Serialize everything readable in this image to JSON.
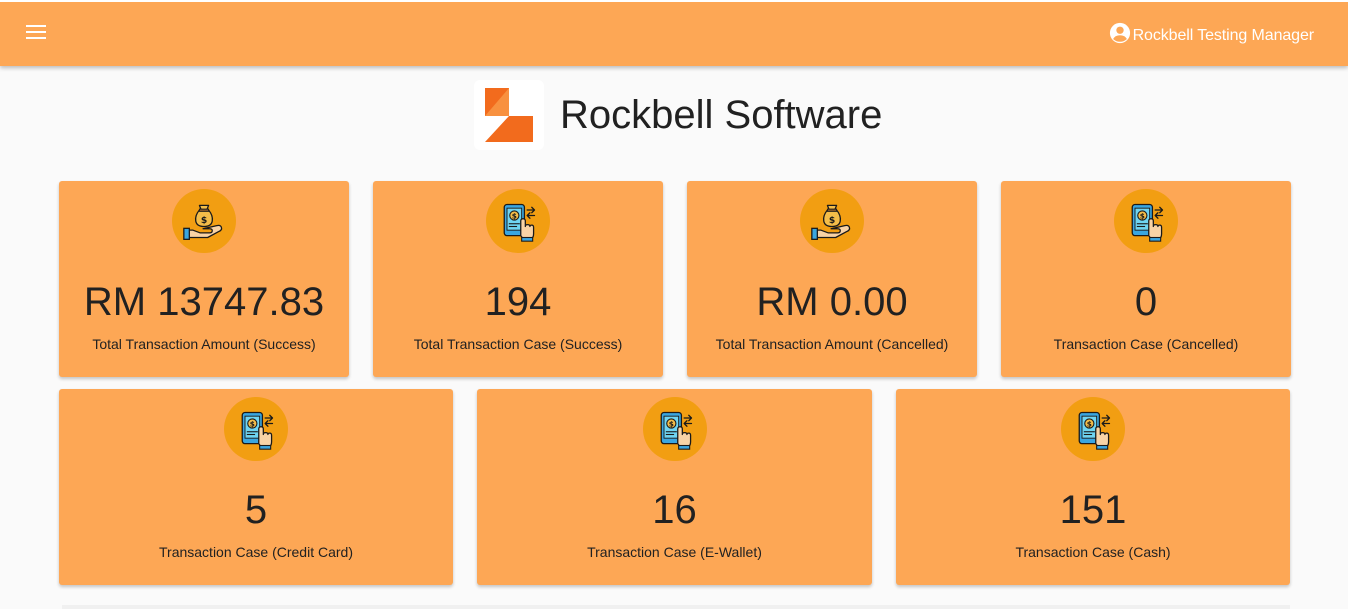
{
  "header": {
    "menu_icon": "menu-icon",
    "user_icon": "account-circle-icon",
    "user_name": "Rockbell Testing Manager"
  },
  "brand": {
    "name": "Rockbell Software",
    "logo_icon": "rockbell-logo",
    "logo_colors": [
      "#f26b1d",
      "#ffffff"
    ]
  },
  "colors": {
    "topbar": "#fda755",
    "card": "#fda755",
    "icon_circle": "#f29e12",
    "background": "#fafafa"
  },
  "cards_row1": [
    {
      "value": "RM 13747.83",
      "label": "Total Transaction Amount (Success)",
      "icon": "money-bag-hand-icon"
    },
    {
      "value": "194",
      "label": "Total Transaction Case (Success)",
      "icon": "phone-payment-icon"
    },
    {
      "value": "RM 0.00",
      "label": "Total Transaction Amount (Cancelled)",
      "icon": "money-bag-hand-icon"
    },
    {
      "value": "0",
      "label": "Transaction Case (Cancelled)",
      "icon": "phone-payment-icon"
    }
  ],
  "cards_row2": [
    {
      "value": "5",
      "label": "Transaction Case (Credit Card)",
      "icon": "phone-payment-icon"
    },
    {
      "value": "16",
      "label": "Transaction Case (E-Wallet)",
      "icon": "phone-payment-icon"
    },
    {
      "value": "151",
      "label": "Transaction Case (Cash)",
      "icon": "phone-payment-icon"
    }
  ]
}
